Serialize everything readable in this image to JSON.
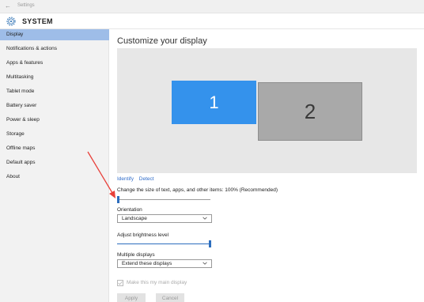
{
  "window": {
    "title": "Settings",
    "back_icon": "back-arrow-icon"
  },
  "header": {
    "title": "SYSTEM",
    "icon": "gear-icon"
  },
  "sidebar": {
    "items": [
      {
        "label": "Display",
        "active": true
      },
      {
        "label": "Notifications & actions",
        "active": false
      },
      {
        "label": "Apps & features",
        "active": false
      },
      {
        "label": "Multitasking",
        "active": false
      },
      {
        "label": "Tablet mode",
        "active": false
      },
      {
        "label": "Battery saver",
        "active": false
      },
      {
        "label": "Power & sleep",
        "active": false
      },
      {
        "label": "Storage",
        "active": false
      },
      {
        "label": "Offline maps",
        "active": false
      },
      {
        "label": "Default apps",
        "active": false
      },
      {
        "label": "About",
        "active": false
      }
    ]
  },
  "main": {
    "title": "Customize your display",
    "monitors": [
      {
        "label": "1",
        "selected": true
      },
      {
        "label": "2",
        "selected": false
      }
    ],
    "links": {
      "identify": "Identify",
      "detect": "Detect"
    },
    "scale": {
      "label": "Change the size of text, apps, and other items: 100% (Recommended)",
      "level": 0
    },
    "orientation": {
      "label": "Orientation",
      "value": "Landscape"
    },
    "brightness": {
      "label": "Adjust brightness level",
      "level": 1.0
    },
    "multiple_displays": {
      "label": "Multiple displays",
      "value": "Extend these displays"
    },
    "main_display_checkbox": {
      "label": "Make this my main display",
      "checked": true,
      "enabled": false
    },
    "buttons": {
      "apply": "Apply",
      "cancel": "Cancel"
    }
  },
  "colors": {
    "accent": "#3492ec",
    "nav_active": "#9ebde8",
    "link": "#2e6bc9",
    "annotation_arrow": "#e8403a"
  }
}
